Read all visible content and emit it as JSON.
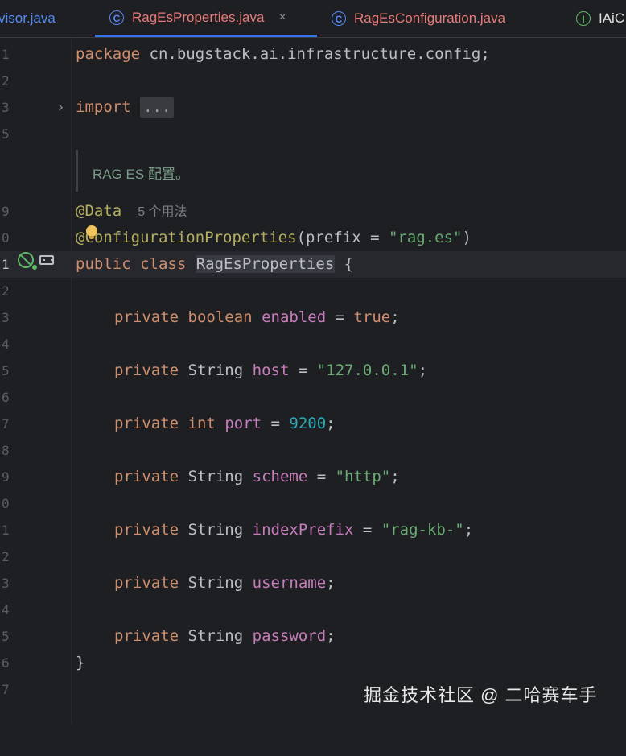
{
  "tabs": [
    {
      "label": "visor.java",
      "active": false,
      "icon": "none"
    },
    {
      "label": "RagEsProperties.java",
      "active": true,
      "icon": "class-icon",
      "close": "×"
    },
    {
      "label": "RagEsConfiguration.java",
      "active": false,
      "icon": "class-icon"
    },
    {
      "label": "IAiC",
      "active": false,
      "icon": "interface-icon"
    }
  ],
  "icon_glyphs": {
    "class": "C",
    "interface": "I"
  },
  "editor": {
    "package_kw": "package",
    "package_name": " cn.bugstack.ai.infrastructure.config;",
    "import_kw": "import",
    "import_fold": "...",
    "doc_comment": "RAG ES 配置。",
    "annotation_data": "@Data",
    "usages": "5 个用法",
    "annotation_config_at": "@",
    "annotation_config_rest": "ConfigurationProperties",
    "annotation_args_open": "(prefix = ",
    "annotation_args_value": "\"rag.es\"",
    "annotation_args_close": ")",
    "class_decl_kw": "public class ",
    "class_name": "RagEsProperties",
    "class_open": " {",
    "fields": [
      {
        "mod": "private",
        "type": "boolean",
        "type_is_kw": true,
        "name": "enabled",
        "assign": " = ",
        "value": "true",
        "value_kind": "kw"
      },
      {
        "mod": "private",
        "type": "String",
        "type_is_kw": false,
        "name": "host",
        "assign": " = ",
        "value": "\"127.0.0.1\"",
        "value_kind": "str"
      },
      {
        "mod": "private",
        "type": "int",
        "type_is_kw": true,
        "name": "port",
        "assign": " = ",
        "value": "9200",
        "value_kind": "num"
      },
      {
        "mod": "private",
        "type": "String",
        "type_is_kw": false,
        "name": "scheme",
        "assign": " = ",
        "value": "\"http\"",
        "value_kind": "str"
      },
      {
        "mod": "private",
        "type": "String",
        "type_is_kw": false,
        "name": "indexPrefix",
        "assign": " = ",
        "value": "\"rag-kb-\"",
        "value_kind": "str"
      },
      {
        "mod": "private",
        "type": "String",
        "type_is_kw": false,
        "name": "username",
        "assign": "",
        "value": "",
        "value_kind": "none"
      },
      {
        "mod": "private",
        "type": "String",
        "type_is_kw": false,
        "name": "password",
        "assign": "",
        "value": "",
        "value_kind": "none"
      }
    ],
    "class_close": "}",
    "line_numbers": [
      "1",
      "2",
      "3",
      "5",
      "9",
      "0",
      "1",
      "2",
      "3",
      "4",
      "5",
      "6",
      "7",
      "8",
      "9",
      "0",
      "1",
      "2",
      "3",
      "4",
      "5",
      "6",
      "7"
    ]
  },
  "watermark": "掘金技术社区 @ 二哈赛车手",
  "colors": {
    "background": "#1e1f22",
    "keyword": "#cf8e6d",
    "string": "#6aab73",
    "number": "#2aacb8",
    "field": "#c77dbb",
    "annotation": "#b3ae60",
    "active_tab_underline": "#3574f0"
  }
}
